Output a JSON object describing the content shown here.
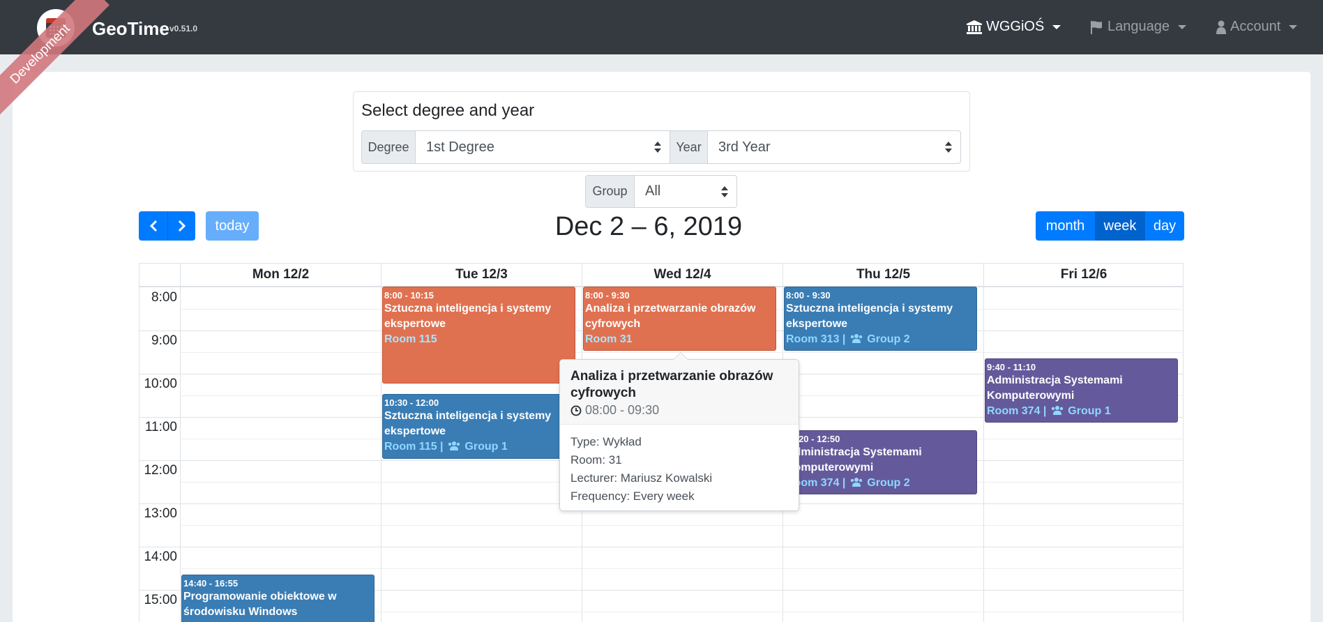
{
  "app": {
    "name": "GeoTime",
    "version": "v0.51.0",
    "env_ribbon": "Development"
  },
  "navbar": {
    "faculty": {
      "label": "WGGiOŚ",
      "icon": "institution-icon"
    },
    "language": {
      "label": "Language",
      "icon": "flag-icon"
    },
    "account": {
      "label": "Account",
      "icon": "user-icon"
    }
  },
  "selector": {
    "heading": "Select degree and year",
    "degree_label": "Degree",
    "degree_value": "1st Degree",
    "year_label": "Year",
    "year_value": "3rd Year",
    "group_label": "Group",
    "group_value": "All"
  },
  "toolbar": {
    "today_label": "today",
    "title": "Dec 2 – 6, 2019",
    "month_label": "month",
    "week_label": "week",
    "day_label": "day",
    "active_view": "week"
  },
  "calendar": {
    "days": [
      "Mon 12/2",
      "Tue 12/3",
      "Wed 12/4",
      "Thu 12/5",
      "Fri 12/6"
    ],
    "hours": [
      "8:00",
      "9:00",
      "10:00",
      "11:00",
      "12:00",
      "13:00",
      "14:00",
      "15:00"
    ],
    "events": [
      {
        "day": 1,
        "start": "8:00",
        "end": "10:15",
        "time": "8:00 - 10:15",
        "title": "Sztuczna inteligencja i systemy ekspertowe",
        "room": "Room 115",
        "group": "",
        "color": "#e07150"
      },
      {
        "day": 1,
        "start": "10:30",
        "end": "12:00",
        "time": "10:30 - 12:00",
        "title": "Sztuczna inteligencja i systemy ekspertowe",
        "room": "Room 115 |",
        "group": "Group 1",
        "color": "#3a7db5"
      },
      {
        "day": 2,
        "start": "8:00",
        "end": "9:30",
        "time": "8:00 - 9:30",
        "title": "Analiza i przetwarzanie obrazów cyfrowych",
        "room": "Room 31",
        "group": "",
        "color": "#e07150"
      },
      {
        "day": 3,
        "start": "8:00",
        "end": "9:30",
        "time": "8:00 - 9:30",
        "title": "Sztuczna inteligencja i systemy ekspertowe",
        "room": "Room 313 |",
        "group": "Group 2",
        "color": "#3a7db5"
      },
      {
        "day": 3,
        "start": "11:20",
        "end": "12:50",
        "time": "11:20 - 12:50",
        "title": "Administracja Systemami Komputerowymi",
        "room": "Room 374 |",
        "group": "Group 2",
        "color": "#645a9b"
      },
      {
        "day": 4,
        "start": "9:40",
        "end": "11:10",
        "time": "9:40 - 11:10",
        "title": "Administracja Systemami Komputerowymi",
        "room": "Room 374 |",
        "group": "Group 1",
        "color": "#645a9b"
      },
      {
        "day": 0,
        "start": "14:40",
        "end": "16:55",
        "time": "14:40 - 16:55",
        "title": "Programowanie obiektowe w środowisku Windows",
        "room": "",
        "group": "",
        "color": "#3a7db5"
      }
    ]
  },
  "popover": {
    "title": "Analiza i przetwarzanie obrazów cyfrowych",
    "time": "08:00 - 09:30",
    "type": "Type: Wykład",
    "room": "Room: 31",
    "lecturer": "Lecturer: Mariusz Kowalski",
    "frequency": "Frequency: Every week"
  }
}
